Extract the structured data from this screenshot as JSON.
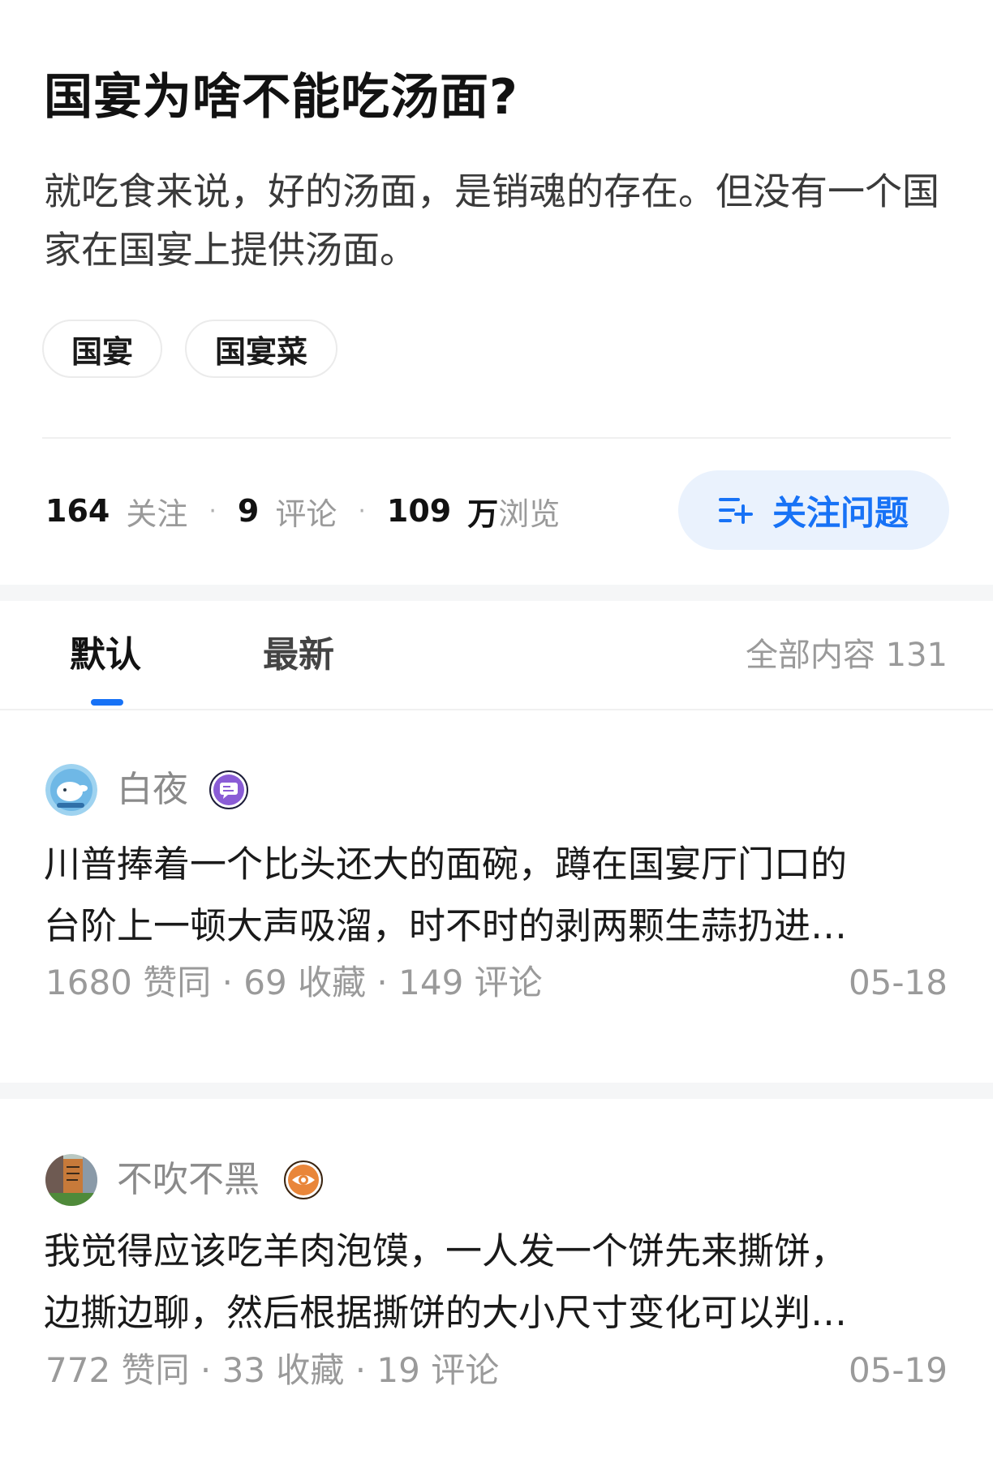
{
  "question": {
    "title": "国宴为啥不能吃汤面?",
    "description": "就吃食来说，好的汤面，是销魂的存在。但没有一个国家在国宴上提供汤面。",
    "tags": [
      "国宴",
      "国宴菜"
    ]
  },
  "stats": {
    "followers": "164",
    "followers_label": "关注",
    "comments": "9",
    "comments_label": "评论",
    "views": "109",
    "views_unit": "万",
    "views_label": "浏览",
    "separator": "·"
  },
  "follow_button": {
    "label": "关注问题",
    "color": "#1772f6",
    "bg": "#eaf2fd"
  },
  "tabs": [
    {
      "label": "默认",
      "active": true
    },
    {
      "label": "最新",
      "active": false
    }
  ],
  "total_label": "全部内容 131",
  "answers": [
    {
      "author": "白夜",
      "badge_icon": "chat-badge-icon",
      "excerpt_line1": "川普捧着一个比头还大的面碗，蹲在国宴厅门口的",
      "excerpt_line2": "台阶上一顿大声吸溜，时不时的剥两颗生蒜扔进…",
      "meta": "1680 赞同 · 69 收藏 · 149 评论",
      "date": "05-18"
    },
    {
      "author": "不吹不黑",
      "badge_icon": "eye-badge-icon",
      "excerpt_line1": "我觉得应该吃羊肉泡馍，一人发一个饼先来撕饼，",
      "excerpt_line2": "边撕边聊，然后根据撕饼的大小尺寸变化可以判…",
      "meta": "772 赞同 · 33 收藏 · 19 评论",
      "date": "05-19"
    }
  ]
}
